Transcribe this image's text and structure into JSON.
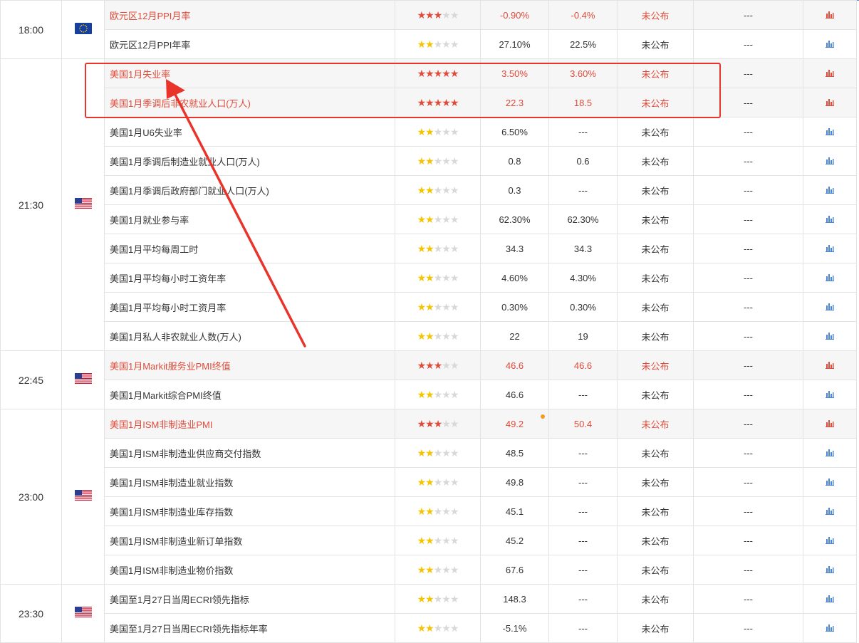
{
  "colors": {
    "highlight_text": "#e04b3a",
    "star_on": "#f5c400",
    "star_off": "#d8d8d8",
    "annotation_red": "#e8342b",
    "grid": "#e3e3e3",
    "row_highlight_bg": "#f6f6f6"
  },
  "star_glyph": "★",
  "groups": [
    {
      "time": "18:00",
      "flag": "eu-flag-icon",
      "rows": [
        {
          "name": "欧元区12月PPI月率",
          "stars": 3,
          "prev": "-0.90%",
          "forecast": "-0.4%",
          "actual": "未公布",
          "extra": "---",
          "important": true
        },
        {
          "name": "欧元区12月PPI年率",
          "stars": 2,
          "prev": "27.10%",
          "forecast": "22.5%",
          "actual": "未公布",
          "extra": "---",
          "important": false
        }
      ]
    },
    {
      "time": "21:30",
      "flag": "us-flag-icon",
      "rows": [
        {
          "name": "美国1月失业率",
          "stars": 5,
          "prev": "3.50%",
          "forecast": "3.60%",
          "actual": "未公布",
          "extra": "---",
          "important": true
        },
        {
          "name": "美国1月季调后非农就业人口(万人)",
          "stars": 5,
          "prev": "22.3",
          "forecast": "18.5",
          "actual": "未公布",
          "extra": "---",
          "important": true
        },
        {
          "name": "美国1月U6失业率",
          "stars": 2,
          "prev": "6.50%",
          "forecast": "---",
          "actual": "未公布",
          "extra": "---",
          "important": false
        },
        {
          "name": "美国1月季调后制造业就业人口(万人)",
          "stars": 2,
          "prev": "0.8",
          "forecast": "0.6",
          "actual": "未公布",
          "extra": "---",
          "important": false
        },
        {
          "name": "美国1月季调后政府部门就业人口(万人)",
          "stars": 2,
          "prev": "0.3",
          "forecast": "---",
          "actual": "未公布",
          "extra": "---",
          "important": false
        },
        {
          "name": "美国1月就业参与率",
          "stars": 2,
          "prev": "62.30%",
          "forecast": "62.30%",
          "actual": "未公布",
          "extra": "---",
          "important": false
        },
        {
          "name": "美国1月平均每周工时",
          "stars": 2,
          "prev": "34.3",
          "forecast": "34.3",
          "actual": "未公布",
          "extra": "---",
          "important": false
        },
        {
          "name": "美国1月平均每小时工资年率",
          "stars": 2,
          "prev": "4.60%",
          "forecast": "4.30%",
          "actual": "未公布",
          "extra": "---",
          "important": false
        },
        {
          "name": "美国1月平均每小时工资月率",
          "stars": 2,
          "prev": "0.30%",
          "forecast": "0.30%",
          "actual": "未公布",
          "extra": "---",
          "important": false
        },
        {
          "name": "美国1月私人非农就业人数(万人)",
          "stars": 2,
          "prev": "22",
          "forecast": "19",
          "actual": "未公布",
          "extra": "---",
          "important": false
        }
      ]
    },
    {
      "time": "22:45",
      "flag": "us-flag-icon",
      "rows": [
        {
          "name": "美国1月Markit服务业PMI终值",
          "stars": 3,
          "prev": "46.6",
          "forecast": "46.6",
          "actual": "未公布",
          "extra": "---",
          "important": true
        },
        {
          "name": "美国1月Markit综合PMI终值",
          "stars": 2,
          "prev": "46.6",
          "forecast": "---",
          "actual": "未公布",
          "extra": "---",
          "important": false
        }
      ]
    },
    {
      "time": "23:00",
      "flag": "us-flag-icon",
      "rows": [
        {
          "name": "美国1月ISM非制造业PMI",
          "stars": 3,
          "prev": "49.2",
          "forecast": "50.4",
          "actual": "未公布",
          "extra": "---",
          "important": true
        },
        {
          "name": "美国1月ISM非制造业供应商交付指数",
          "stars": 2,
          "prev": "48.5",
          "forecast": "---",
          "actual": "未公布",
          "extra": "---",
          "important": false
        },
        {
          "name": "美国1月ISM非制造业就业指数",
          "stars": 2,
          "prev": "49.8",
          "forecast": "---",
          "actual": "未公布",
          "extra": "---",
          "important": false
        },
        {
          "name": "美国1月ISM非制造业库存指数",
          "stars": 2,
          "prev": "45.1",
          "forecast": "---",
          "actual": "未公布",
          "extra": "---",
          "important": false
        },
        {
          "name": "美国1月ISM非制造业新订单指数",
          "stars": 2,
          "prev": "45.2",
          "forecast": "---",
          "actual": "未公布",
          "extra": "---",
          "important": false
        },
        {
          "name": "美国1月ISM非制造业物价指数",
          "stars": 2,
          "prev": "67.6",
          "forecast": "---",
          "actual": "未公布",
          "extra": "---",
          "important": false
        }
      ]
    },
    {
      "time": "23:30",
      "flag": "us-flag-icon",
      "rows": [
        {
          "name": "美国至1月27日当周ECRI领先指标",
          "stars": 2,
          "prev": "148.3",
          "forecast": "---",
          "actual": "未公布",
          "extra": "---",
          "important": false
        },
        {
          "name": "美国至1月27日当周ECRI领先指标年率",
          "stars": 2,
          "prev": "-5.1%",
          "forecast": "---",
          "actual": "未公布",
          "extra": "---",
          "important": false
        }
      ]
    }
  ]
}
